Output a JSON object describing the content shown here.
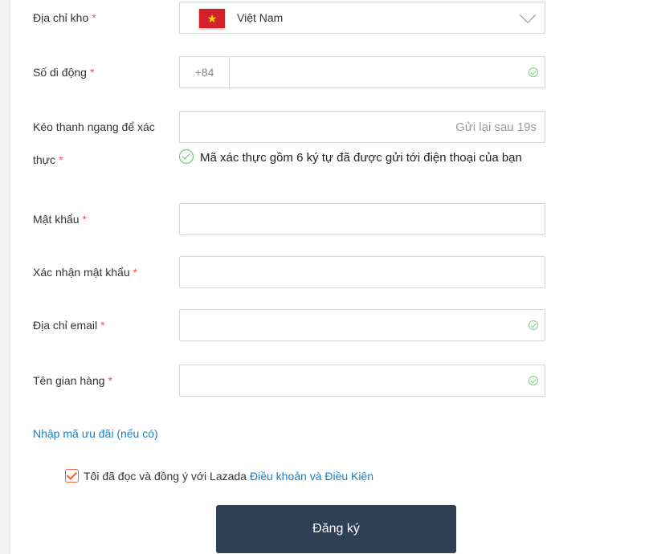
{
  "form": {
    "required_mark": "*",
    "address": {
      "label": "Địa chỉ kho",
      "country": "Việt Nam",
      "flag_icon": "vietnam-flag-icon",
      "flag_color": "#d1222b"
    },
    "phone": {
      "label": "Số di động",
      "prefix": "+84",
      "value": ""
    },
    "verify": {
      "label_line1": "Kéo thanh ngang để xác",
      "label_line2": "thực",
      "resend_text": "Gửi lại sau 19s",
      "message": "Mã xác thực gồm 6 ký tự đã được gửi tới điện thoại của bạn"
    },
    "password": {
      "label": "Mật khẩu",
      "value": ""
    },
    "confirm_password": {
      "label": "Xác nhận mật khẩu",
      "value": ""
    },
    "email": {
      "label": "Địa chỉ email",
      "value": ""
    },
    "shop_name": {
      "label": "Tên gian hàng",
      "value": ""
    },
    "promo_link": "Nhập mã ưu đãi (nếu có)",
    "terms": {
      "text": "Tôi đã đọc và đồng ý với Lazada",
      "link": "Điều khoản và Điều Kiện",
      "checked": true
    },
    "submit_label": "Đăng ký"
  },
  "colors": {
    "accent_link": "#1a7fc4",
    "button_bg": "#2e3f56",
    "required": "#e55555",
    "success": "#5bbf6b",
    "checkbox": "#e5623a"
  }
}
